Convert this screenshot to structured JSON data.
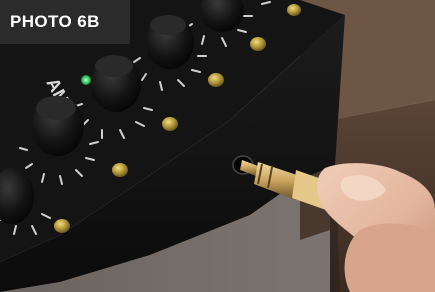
{
  "photo": {
    "label": "PHOTO 6B",
    "panel_text": "AMICU",
    "colors": {
      "panel": "#151515",
      "table": "#4a382c",
      "led_green": "#3fd06a",
      "led_amber": "#b59a3c",
      "plug_gold": "#c9a25c",
      "skin": "#e2b49c"
    }
  }
}
